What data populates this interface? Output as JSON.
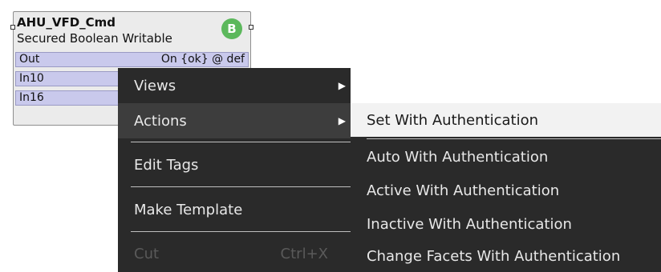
{
  "component": {
    "name": "AHU_VFD_Cmd",
    "type": "Secured Boolean Writable",
    "badge": "B",
    "slots": [
      {
        "name": "Out",
        "value": "On {ok} @ def"
      },
      {
        "name": "In10",
        "value": ""
      },
      {
        "name": "In16",
        "value": ""
      }
    ]
  },
  "context_menu": {
    "items": [
      {
        "label": "Views",
        "submenu": true
      },
      {
        "label": "Actions",
        "submenu": true,
        "active": true
      },
      {
        "label": "Edit Tags"
      },
      {
        "label": "Make Template"
      },
      {
        "label": "Cut",
        "shortcut": "Ctrl+X",
        "disabled": true
      }
    ]
  },
  "actions_submenu": {
    "items": [
      {
        "label": "Set With Authentication",
        "highlighted": true
      },
      {
        "label": "Auto With Authentication"
      },
      {
        "label": "Active With Authentication"
      },
      {
        "label": "Inactive With Authentication"
      },
      {
        "label": "Change Facets With Authentication"
      }
    ]
  },
  "colors": {
    "menu_bg": "#2a2a2a",
    "highlight_bg": "#f2f2f2",
    "slot_bg": "#c9c9ec",
    "badge": "#5cb85c"
  },
  "icons": {
    "submenu_arrow": "triangle-right-icon",
    "component_badge": "boolean-badge-icon"
  }
}
